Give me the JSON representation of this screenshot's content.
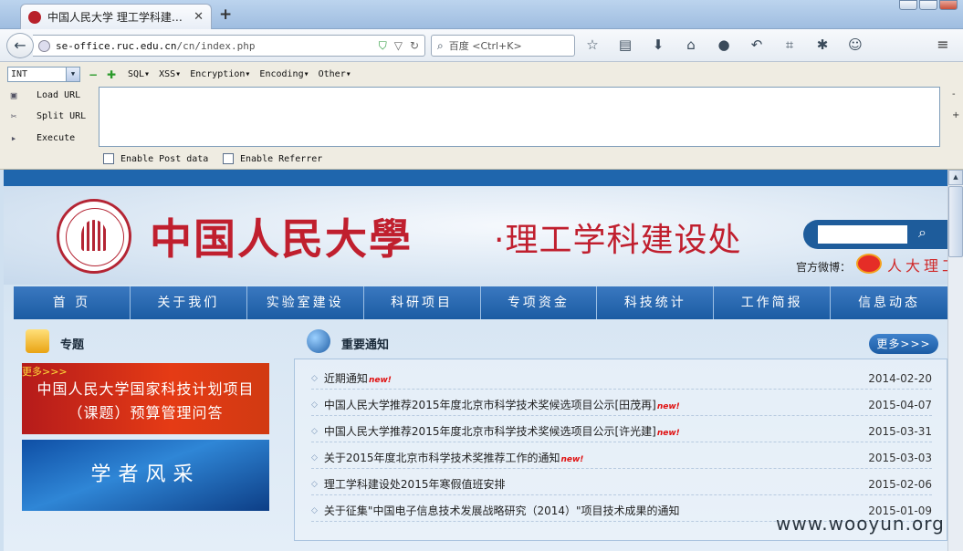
{
  "browser": {
    "tab_title": "中国人民大学 理工学科建设处",
    "new_tab": "+",
    "url_host": "se-office.ruc.edu.cn",
    "url_path": "/cn/index.php",
    "search_placeholder": "百度 <Ctrl+K>"
  },
  "hackbar": {
    "select_value": "INT",
    "menu": [
      "SQL▾",
      "XSS▾",
      "Encryption▾",
      "Encoding▾",
      "Other▾"
    ],
    "load_url": "Load URL",
    "split_url": "Split URL",
    "execute": "Execute",
    "enable_post": "Enable Post data",
    "enable_referrer": "Enable Referrer",
    "textarea_value": ""
  },
  "site": {
    "name": "中国人民大學",
    "sub": "·理工学科建设处",
    "weibo_label": "官方微博：",
    "weibo_name": "人大理工"
  },
  "nav": [
    "首 页",
    "关于我们",
    "实验室建设",
    "科研项目",
    "专项资金",
    "科技统计",
    "工作简报",
    "信息动态"
  ],
  "topic": {
    "title": "专题",
    "more": "更多>>>",
    "banner1": "中国人民大学国家科技计划项目（课题）预算管理问答",
    "banner2": "学者风采"
  },
  "notices": {
    "title": "重要通知",
    "more": "更多>>>",
    "new_tag": "new!",
    "items": [
      {
        "text": "近期通知",
        "new": true,
        "date": "2014-02-20"
      },
      {
        "text": "中国人民大学推荐2015年度北京市科学技术奖候选项目公示[田茂再]",
        "new": true,
        "date": "2015-04-07"
      },
      {
        "text": "中国人民大学推荐2015年度北京市科学技术奖候选项目公示[许光建]",
        "new": true,
        "date": "2015-03-31"
      },
      {
        "text": "关于2015年度北京市科学技术奖推荐工作的通知",
        "new": true,
        "date": "2015-03-03"
      },
      {
        "text": "理工学科建设处2015年寒假值班安排",
        "new": false,
        "date": "2015-02-06"
      },
      {
        "text": "关于征集\"中国电子信息技术发展战略研究（2014）\"项目技术成果的通知",
        "new": false,
        "date": "2015-01-09"
      }
    ]
  },
  "watermark": "www.wooyun.org"
}
